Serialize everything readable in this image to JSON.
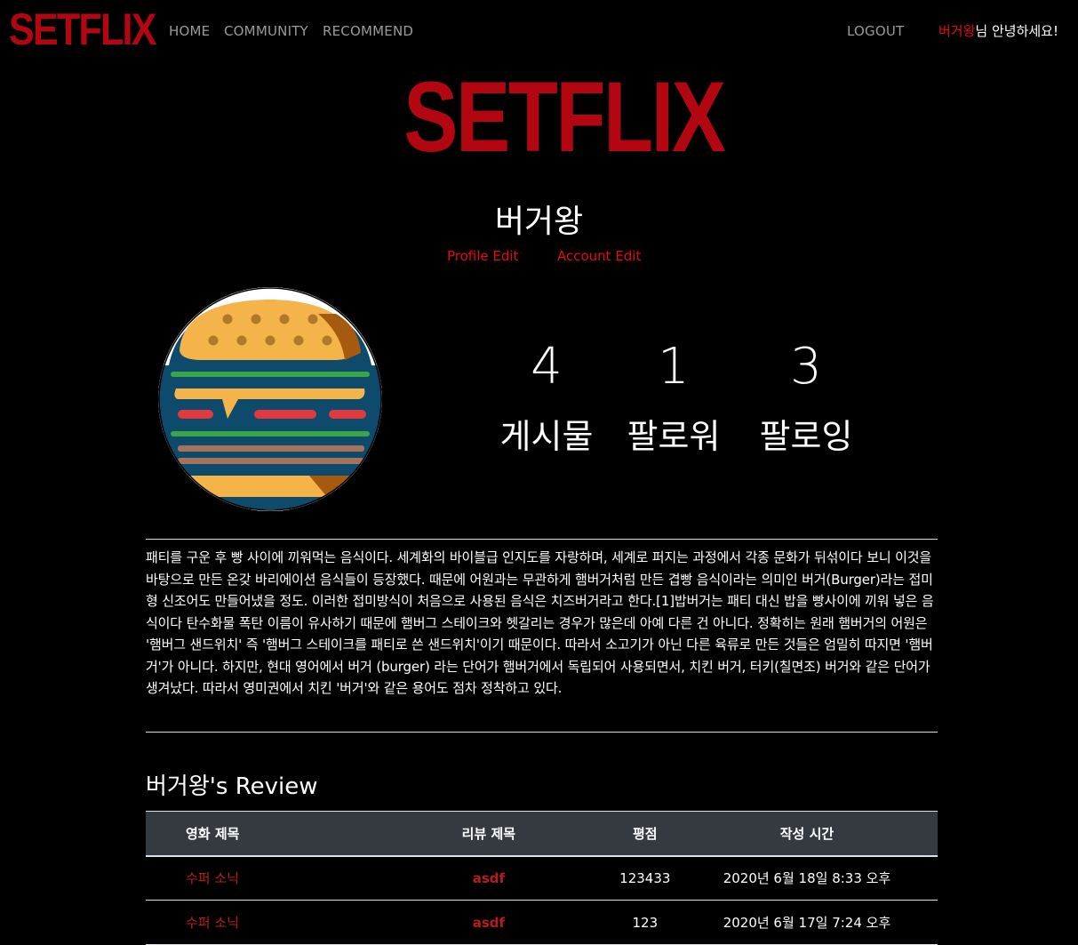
{
  "nav": {
    "logo": "SETFLIX",
    "links": [
      "HOME",
      "COMMUNITY",
      "RECOMMEND"
    ],
    "logout": "LOGOUT",
    "greeting_user": "버거왕",
    "greeting_suffix": "님 안녕하세요!"
  },
  "hero": {
    "logo": "SETFLIX"
  },
  "profile": {
    "username": "버거왕",
    "profile_edit": "Profile Edit",
    "account_edit": "Account Edit",
    "stats": [
      {
        "value": "4",
        "label": "게시물"
      },
      {
        "value": "1",
        "label": "팔로워"
      },
      {
        "value": "3",
        "label": "팔로잉"
      }
    ],
    "bio": "패티를 구운 후 빵 사이에 끼워먹는 음식이다. 세계화의 바이블급 인지도를 자랑하며, 세계로 퍼지는 과정에서 각종 문화가 뒤섞이다 보니 이것을 바탕으로 만든 온갖 바리에이션 음식들이 등장했다. 때문에 어원과는 무관하게 햄버거처럼 만든 겹빵 음식이라는 의미인 버거(Burger)라는 접미형 신조어도 만들어냈을 정도. 이러한 접미방식이 처음으로 사용된 음식은 치즈버거라고 한다.[1]밥버거는 패티 대신 밥을 빵사이에 끼워 넣은 음식이다 탄수화물 폭탄 이름이 유사하기 때문에 햄버그 스테이크와 헷갈리는 경우가 많은데 아예 다른 건 아니다. 정확히는 원래 햄버거의 어원은 '햄버그 샌드위치' 즉 '햄버그 스테이크를 패티로 쓴 샌드위치'이기 때문이다. 따라서 소고기가 아닌 다른 육류로 만든 것들은 엄밀히 따지면 '햄버거'가 아니다. 하지만, 현대 영어에서 버거 (burger) 라는 단어가 햄버거에서 독립되어 사용되면서, 치킨 버거, 터키(칠면조) 버거와 같은 단어가 생겨났다. 따라서 영미권에서 치킨 '버거'와 같은 용어도 점차 정착하고 있다."
  },
  "reviews": {
    "heading": "버거왕's Review",
    "columns": [
      "영화 제목",
      "리뷰 제목",
      "평점",
      "작성 시간"
    ],
    "rows": [
      {
        "movie": "수퍼 소닉",
        "title": "asdf",
        "score": "123433",
        "time": "2020년 6월 18일 8:33 오후"
      },
      {
        "movie": "수퍼 소닉",
        "title": "asdf",
        "score": "123",
        "time": "2020년 6월 17일 7:24 오후"
      }
    ]
  },
  "colors": {
    "brand": "#b20710",
    "accent": "#e50914",
    "table_header": "#343a40"
  }
}
